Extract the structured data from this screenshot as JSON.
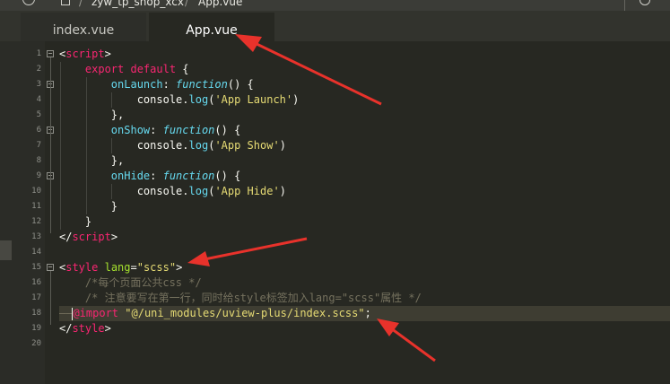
{
  "breadcrumb": {
    "project": "zyw_tp_shop_xcx",
    "file": "App.vue"
  },
  "tabs": [
    {
      "label": "index.vue",
      "active": false
    },
    {
      "label": "App.vue",
      "active": true
    }
  ],
  "editor": {
    "active_line": 18,
    "lines": [
      {
        "n": "1"
      },
      {
        "n": "2"
      },
      {
        "n": "3"
      },
      {
        "n": "4"
      },
      {
        "n": "5"
      },
      {
        "n": "6"
      },
      {
        "n": "7"
      },
      {
        "n": "8"
      },
      {
        "n": "9"
      },
      {
        "n": "10"
      },
      {
        "n": "11"
      },
      {
        "n": "12"
      },
      {
        "n": "13"
      },
      {
        "n": "14"
      },
      {
        "n": "15"
      },
      {
        "n": "16"
      },
      {
        "n": "17"
      },
      {
        "n": "18"
      },
      {
        "n": "19"
      },
      {
        "n": "20"
      }
    ],
    "code": {
      "l1_tag": "script",
      "l2_kw": "export default",
      "l3_name": "onLaunch",
      "fn_kw": "function",
      "console": "console",
      "log": "log",
      "l4_str": "'App Launch'",
      "l6_name": "onShow",
      "l7_str": "'App Show'",
      "l9_name": "onHide",
      "l10_str": "'App Hide'",
      "l13_tag": "script",
      "l15_tag": "style",
      "l15_attr": "lang",
      "l15_val": "\"scss\"",
      "l16_cmt": "/*每个页面公共css */",
      "l17_cmt": "/* 注意要写在第一行，同时给style标签加入lang=\"scss\"属性 */",
      "l18_at": "@import",
      "l18_str": "\"@/uni_modules/uview-plus/index.scss\"",
      "l19_tag": "style"
    }
  },
  "colors": {
    "background": "#272822",
    "annotation_arrow": "#e8322b"
  }
}
